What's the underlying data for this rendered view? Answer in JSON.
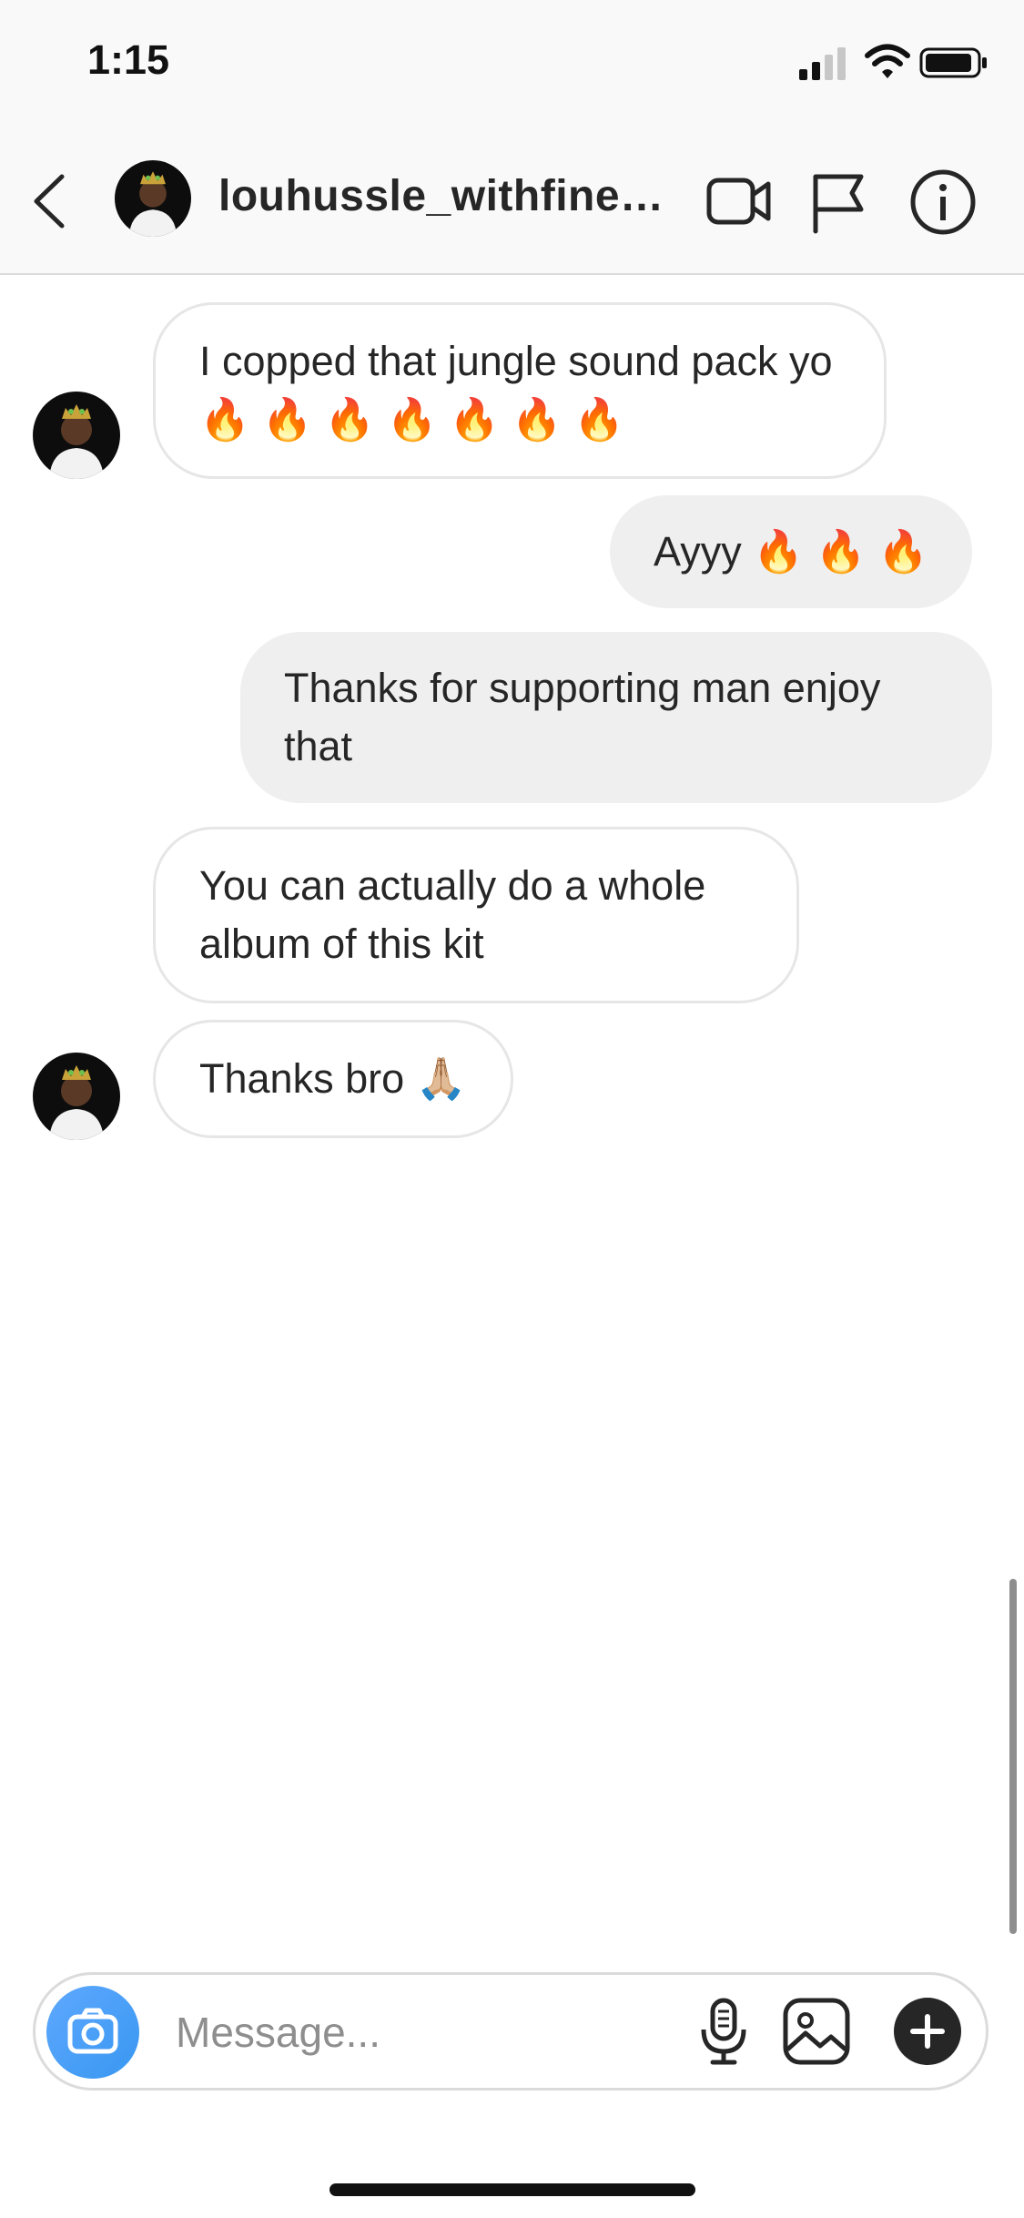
{
  "status_bar": {
    "time": "1:15"
  },
  "header": {
    "username": "louhussle_withfinesse",
    "icons": [
      "chevron-left-icon",
      "video-camera-icon",
      "flag-icon",
      "info-icon"
    ]
  },
  "messages": [
    {
      "direction": "incoming",
      "text": "I copped that jungle sound pack yo 🔥 🔥 🔥 🔥 🔥 🔥 🔥"
    },
    {
      "direction": "outgoing",
      "text": "Ayyy 🔥 🔥 🔥"
    },
    {
      "direction": "outgoing",
      "text": "Thanks for supporting man enjoy that"
    },
    {
      "direction": "incoming",
      "text": "You can actually do a whole album of this kit"
    },
    {
      "direction": "incoming",
      "text": "Thanks bro 🙏🏼"
    }
  ],
  "composer": {
    "placeholder": "Message...",
    "icons": [
      "camera-icon",
      "microphone-icon",
      "gallery-icon",
      "plus-icon"
    ]
  },
  "colors": {
    "accent": "#3897f0",
    "incoming_border": "#e6e6e6",
    "outgoing_bg": "#efefef"
  }
}
